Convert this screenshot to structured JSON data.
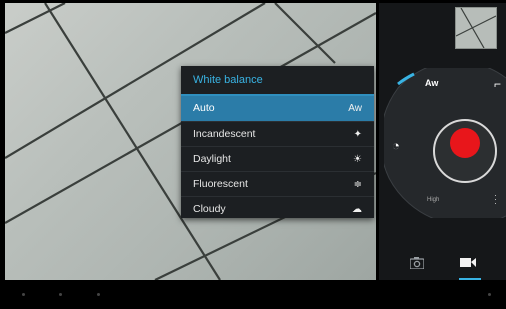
{
  "white_balance": {
    "title": "White balance",
    "selected": "Auto",
    "options": [
      {
        "label": "Auto",
        "icon": "auto-wb-icon",
        "glyph": "Aw"
      },
      {
        "label": "Incandescent",
        "icon": "incandescent-icon",
        "glyph": "✦"
      },
      {
        "label": "Daylight",
        "icon": "daylight-icon",
        "glyph": "☀"
      },
      {
        "label": "Fluorescent",
        "icon": "fluorescent-icon",
        "glyph": "≑"
      },
      {
        "label": "Cloudy",
        "icon": "cloudy-icon",
        "glyph": "☁"
      }
    ]
  },
  "controls": {
    "quality_label": "High",
    "aw_glyph": "Aw"
  },
  "colors": {
    "accent": "#39b3e3",
    "record": "#e8161b",
    "menu_bg": "#1c1f22",
    "selected_bg": "#2b7ca8"
  }
}
